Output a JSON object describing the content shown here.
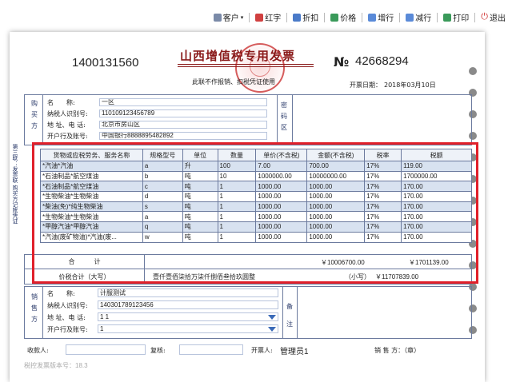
{
  "toolbar": {
    "customer": "客户",
    "red_invoice": "红字",
    "discount": "折扣",
    "price": "价格",
    "add_row": "增行",
    "delete_row": "减行",
    "print": "打印",
    "exit": "退出"
  },
  "invoice": {
    "code": "1400131560",
    "title": "山西增值税专用发票",
    "subtitle": "此联不作报销、扣税凭证使用",
    "no_mark": "№",
    "number": "42668294",
    "issue_date_label": "开票日期：",
    "issue_date": "2018年03月10日"
  },
  "buyer": {
    "side_label": [
      "购",
      "买",
      "方"
    ],
    "name_label": "名　　称:",
    "name": "一区",
    "tax_id_label": "纳税人识别号:",
    "tax_id": "110109123456789",
    "address_label": "地 址、电 话:",
    "address": "北京市房山区",
    "bank_label": "开户行及账号:",
    "bank": "中国银行8888895482892",
    "password_label": [
      "密",
      "码",
      "区"
    ]
  },
  "left_vertical": "第三联：发票联 购买方记账凭证",
  "goods": {
    "headers": [
      "货物或应税劳务、服务名称",
      "规格型号",
      "单位",
      "数量",
      "单价(不含税)",
      "金额(不含税)",
      "税率",
      "税额"
    ],
    "rows": [
      [
        "*汽油*汽油",
        "a",
        "升",
        "100",
        "7.00",
        "700.00",
        "17%",
        "119.00"
      ],
      [
        "*石油制品*航空煤油",
        "b",
        "吨",
        "10",
        "1000000.00",
        "10000000.00",
        "17%",
        "1700000.00"
      ],
      [
        "*石油制品*航空煤油",
        "c",
        "吨",
        "1",
        "1000.00",
        "1000.00",
        "17%",
        "170.00"
      ],
      [
        "*生物柴油*生物柴油",
        "d",
        "吨",
        "1",
        "1000.00",
        "1000.00",
        "17%",
        "170.00"
      ],
      [
        "*柴油(免)*纯生物柴油",
        "s",
        "吨",
        "1",
        "1000.00",
        "1000.00",
        "17%",
        "170.00"
      ],
      [
        "*生物柴油*生物柴油",
        "a",
        "吨",
        "1",
        "1000.00",
        "1000.00",
        "17%",
        "170.00"
      ],
      [
        "*甲醇汽油*甲醇汽油",
        "q",
        "吨",
        "1",
        "1000.00",
        "1000.00",
        "17%",
        "170.00"
      ],
      [
        "*汽油(废矿物油)*汽油(废...",
        "w",
        "吨",
        "1",
        "1000.00",
        "1000.00",
        "17%",
        "170.00"
      ]
    ]
  },
  "summary": {
    "total_label": "合　　　计",
    "total_amount": "￥10006700.00",
    "total_tax": "￥1701139.00",
    "grand_label": "价税合计（大写）",
    "grand_upper": "壹仟壹佰柒拾万柒仟捌佰叁拾玖圆整",
    "grand_lower_label": "（小写）",
    "grand_lower": "￥11707839.00"
  },
  "seller": {
    "side_label": [
      "销",
      "售",
      "方"
    ],
    "name_label": "名　　称:",
    "name": "计服测试",
    "tax_id_label": "纳税人识别号:",
    "tax_id": "140301789123456",
    "address_label": "地 址、电 话:",
    "address": "1 1",
    "bank_label": "开户行及账号:",
    "bank": "1",
    "remark_label": [
      "备",
      "注"
    ]
  },
  "footer": {
    "payee_label": "收款人:",
    "reviewer_label": "复核:",
    "drawer_label": "开票人:",
    "drawer": "管理员1",
    "seller_stamp_label": "销 售 方：（章）"
  },
  "version": "税控发票版本号：18.3"
}
